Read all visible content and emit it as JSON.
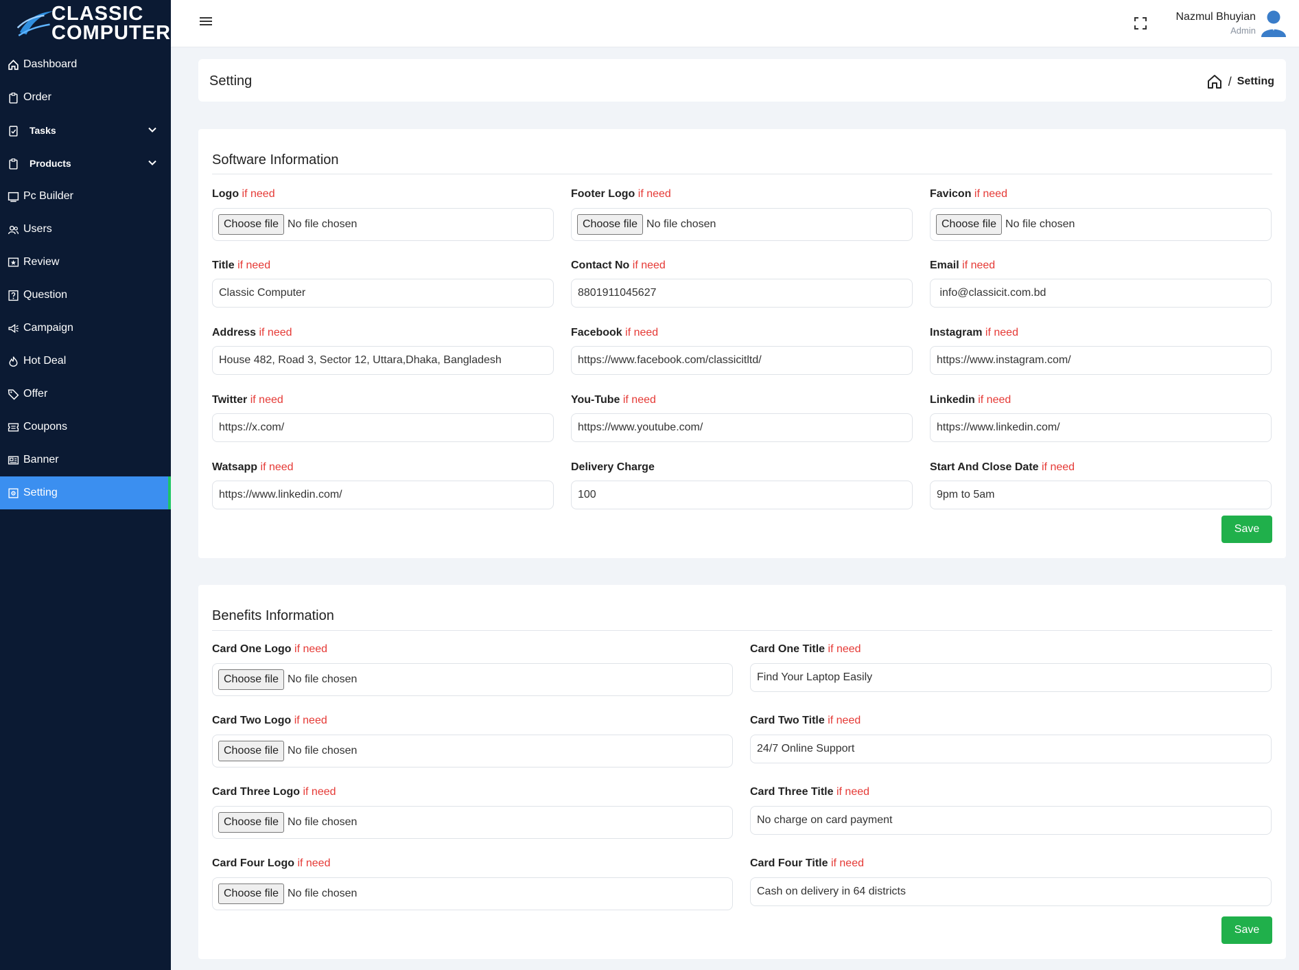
{
  "brand": {
    "line1": "CLASSIC",
    "line2": "COMPUTER"
  },
  "sidebar": {
    "items": [
      {
        "label": "Dashboard",
        "icon": "home-icon"
      },
      {
        "label": "Order",
        "icon": "clipboard-icon"
      },
      {
        "label": "Tasks",
        "icon": "task-icon",
        "expandable": true
      },
      {
        "label": "Products",
        "icon": "box-icon",
        "expandable": true
      },
      {
        "label": "Pc Builder",
        "icon": "monitor-icon"
      },
      {
        "label": "Users",
        "icon": "users-icon"
      },
      {
        "label": "Review",
        "icon": "star-icon"
      },
      {
        "label": "Question",
        "icon": "question-icon"
      },
      {
        "label": "Campaign",
        "icon": "megaphone-icon"
      },
      {
        "label": "Hot Deal",
        "icon": "fire-icon"
      },
      {
        "label": "Offer",
        "icon": "tag-icon"
      },
      {
        "label": "Coupons",
        "icon": "coupon-icon"
      },
      {
        "label": "Banner",
        "icon": "banner-icon"
      },
      {
        "label": "Setting",
        "icon": "gear-icon",
        "active": true
      }
    ]
  },
  "topbar": {
    "user_name": "Nazmul Bhuyian",
    "user_role": "Admin"
  },
  "page": {
    "title": "Setting",
    "breadcrumb_current": "Setting",
    "breadcrumb_sep": "/"
  },
  "common": {
    "need": "if need",
    "choose_file": "Choose file",
    "no_file": "No file chosen",
    "save": "Save"
  },
  "software": {
    "title": "Software Information",
    "logo": "Logo",
    "footer_logo": "Footer Logo",
    "favicon": "Favicon",
    "title_label": "Title",
    "title_value": "Classic Computer",
    "contact_label": "Contact No",
    "contact_value": "8801911045627",
    "email_label": "Email",
    "email_value": " info@classicit.com.bd",
    "address_label": "Address",
    "address_value": "House 482, Road 3, Sector 12, Uttara,Dhaka, Bangladesh",
    "facebook_label": "Facebook",
    "facebook_value": "https://www.facebook.com/classicitltd/",
    "instagram_label": "Instagram",
    "instagram_value": "https://www.instagram.com/",
    "twitter_label": "Twitter",
    "twitter_value": "https://x.com/",
    "youtube_label": "You-Tube",
    "youtube_value": "https://www.youtube.com/",
    "linkedin_label": "Linkedin",
    "linkedin_value": "https://www.linkedin.com/",
    "watsapp_label": "Watsapp",
    "watsapp_value": "https://www.linkedin.com/",
    "delivery_label": "Delivery Charge",
    "delivery_value": "100",
    "hours_label": "Start And Close Date",
    "hours_value": "9pm to 5am"
  },
  "benefits": {
    "title": "Benefits Information",
    "card1_logo": "Card One Logo",
    "card1_title_label": "Card One Title",
    "card1_title_value": "Find Your Laptop Easily",
    "card2_logo": "Card Two Logo",
    "card2_title_label": "Card Two Title",
    "card2_title_value": "24/7 Online Support",
    "card3_logo": "Card Three Logo",
    "card3_title_label": "Card Three Title",
    "card3_title_value": "No charge on card payment",
    "card4_logo": "Card Four Logo",
    "card4_title_label": "Card Four Title",
    "card4_title_value": "Cash on delivery in 64 districts"
  },
  "colors": {
    "sidebar_bg": "#0b1a33",
    "active_item": "#3b8ff0",
    "save_button": "#20b04b",
    "need_text": "#e53935"
  }
}
